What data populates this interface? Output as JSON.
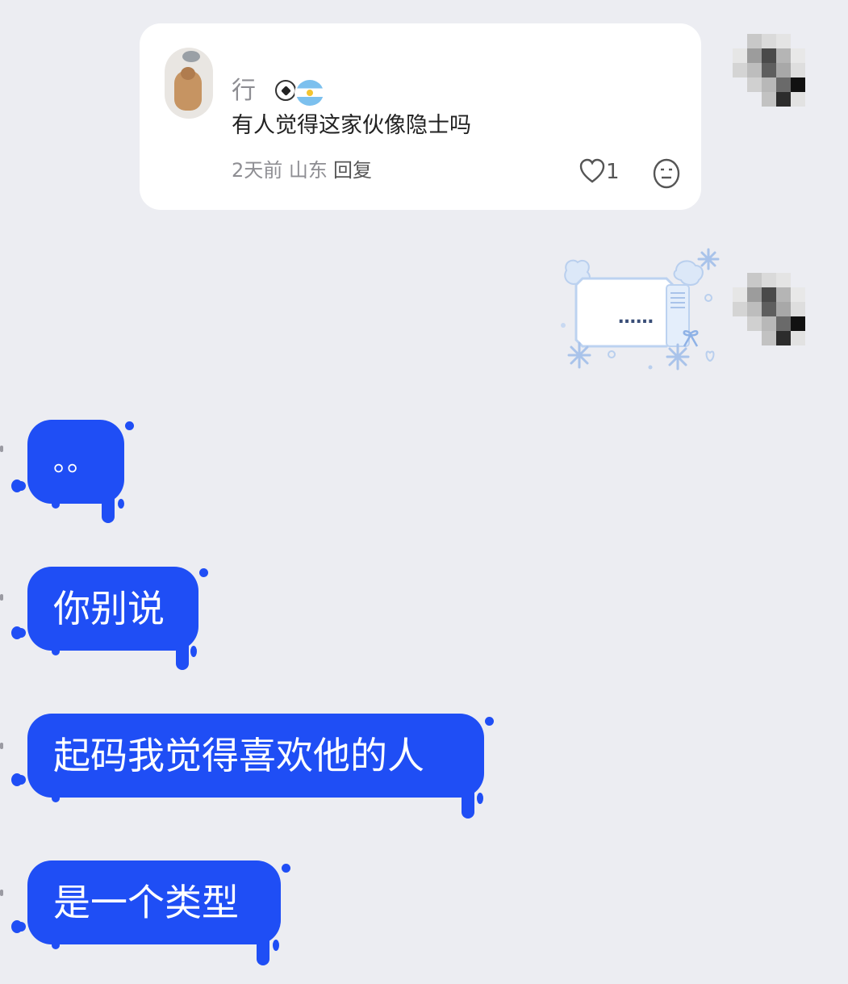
{
  "shared_comment": {
    "username": "行",
    "comment": "有人觉得这家伙像隐士吗",
    "meta": "2天前 山东",
    "reply_label": "回复",
    "like_count": "1"
  },
  "sticker_text": "……",
  "messages": [
    {
      "text": "。。"
    },
    {
      "text": "你别说"
    },
    {
      "text": "起码我觉得喜欢他的人"
    },
    {
      "text": "是一个类型"
    }
  ],
  "colors": {
    "background": "#ECEDF2",
    "bubble_blue": "#1F4EF5",
    "card_white": "#FFFFFF"
  }
}
